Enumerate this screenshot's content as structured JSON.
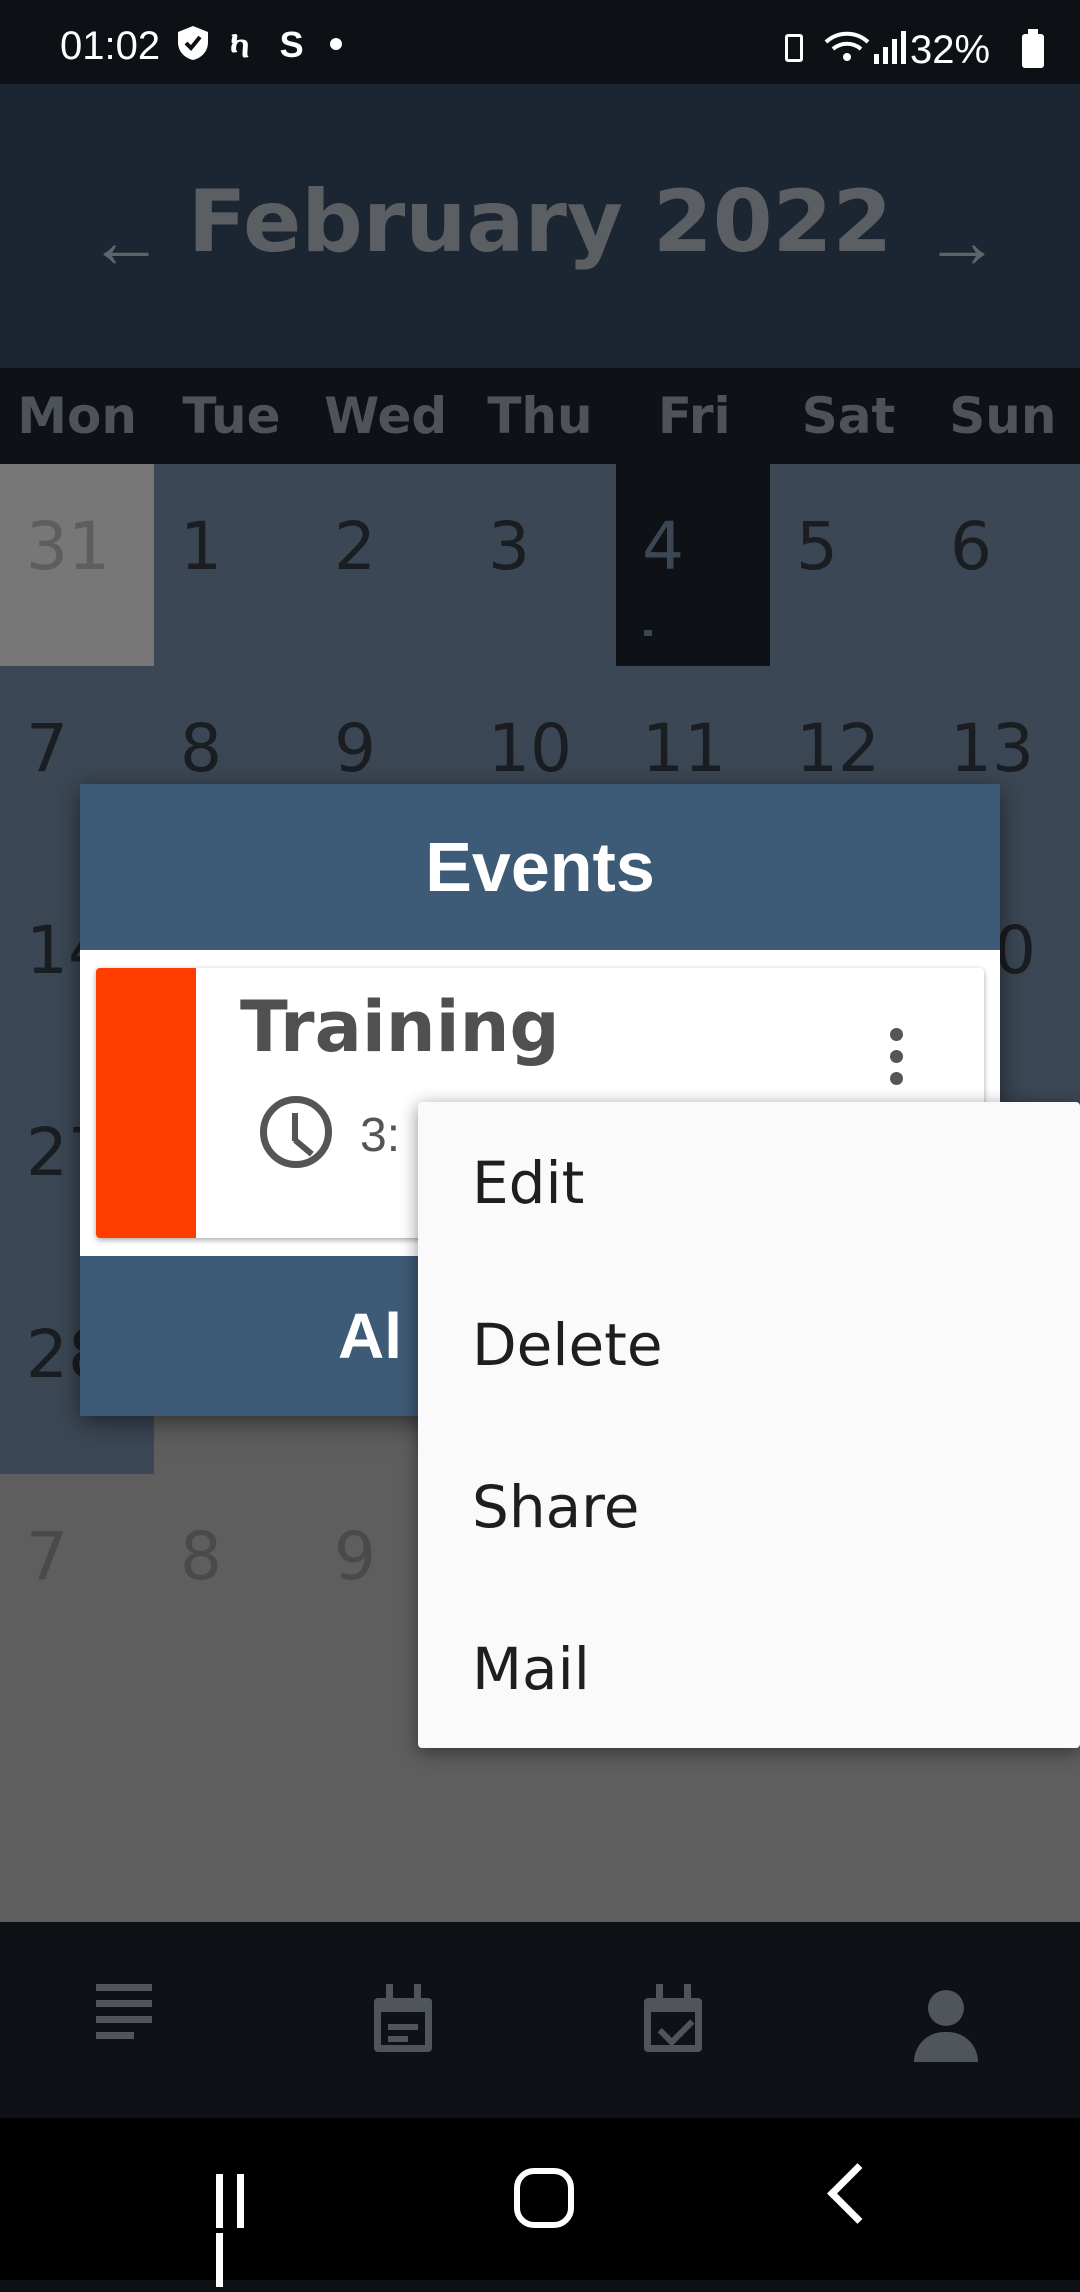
{
  "status_bar": {
    "time": "01:02",
    "left_icons": "ካ S",
    "battery_percent": "32%"
  },
  "header": {
    "title": "February 2022",
    "prev_label": "←",
    "next_label": "→"
  },
  "weekdays": [
    "Mon",
    "Tue",
    "Wed",
    "Thu",
    "Fri",
    "Sat",
    "Sun"
  ],
  "calendar": {
    "rows": [
      [
        "31",
        "1",
        "2",
        "3",
        "4",
        "5",
        "6"
      ],
      [
        "7",
        "8",
        "9",
        "10",
        "11",
        "12",
        "13"
      ],
      [
        "14",
        "",
        "",
        "",
        "",
        "",
        "0"
      ],
      [
        "27",
        "",
        "",
        "",
        "",
        "",
        ""
      ],
      [
        "28",
        "",
        "",
        "",
        "",
        "",
        ""
      ],
      [
        "7",
        "8",
        "9",
        "",
        "",
        "",
        ""
      ]
    ],
    "selected_day": "4"
  },
  "dialog": {
    "title": "Events",
    "event": {
      "title": "Training",
      "time": "3:",
      "color": "#ff3d00"
    },
    "button_label": "Al"
  },
  "menu": {
    "items": [
      "Edit",
      "Delete",
      "Share",
      "Mail"
    ]
  },
  "bottom_nav": {
    "icons": [
      "list-icon",
      "calendar-icon",
      "calendar-check-icon",
      "person-icon"
    ]
  },
  "colors": {
    "header_bg": "#1b2632",
    "dialog_header": "#3d5a76",
    "event_color": "#ff3d00"
  }
}
